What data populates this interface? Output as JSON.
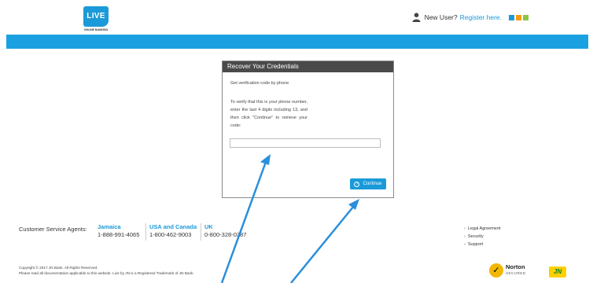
{
  "header": {
    "logo_text": "LIVE",
    "logo_subtext": "ONLINE BANKING",
    "new_user_label": "New User?",
    "register_link": "Register here.",
    "accent_colors": [
      "#1a9ad9",
      "#f39c12",
      "#8dc63f"
    ]
  },
  "dialog": {
    "title": "Recover Your Credentials",
    "subtitle": "Get verification code by phone",
    "instructions": "To verify that this is your phone number, enter the last 4 digits including 13, and then click \"Continue\" to retrieve your code:",
    "input_value": "",
    "continue_label": "Continue"
  },
  "footer": {
    "customer_service_label": "Customer Service Agents:",
    "contacts": [
      {
        "region": "Jamaica",
        "phone": "1-888-991-4065"
      },
      {
        "region": "USA and Canada",
        "phone": "1-800-462-9003"
      },
      {
        "region": "UK",
        "phone": "0-800-328-0387"
      }
    ],
    "links": [
      "Legal Agreement",
      "Security",
      "Support"
    ],
    "copyright_line1": "Copyright © 2017 JN Bank. All Rights Reserved.",
    "copyright_line2": "Please read all documentation applicable to this website. Live by JN is a Registered Trademark of JN Bank.",
    "norton_name": "Norton",
    "norton_sub": "SECURED",
    "jn_logo": "JN"
  },
  "colors": {
    "brand_blue": "#1ba1e2",
    "annotation_arrow": "#2a8fdc"
  }
}
